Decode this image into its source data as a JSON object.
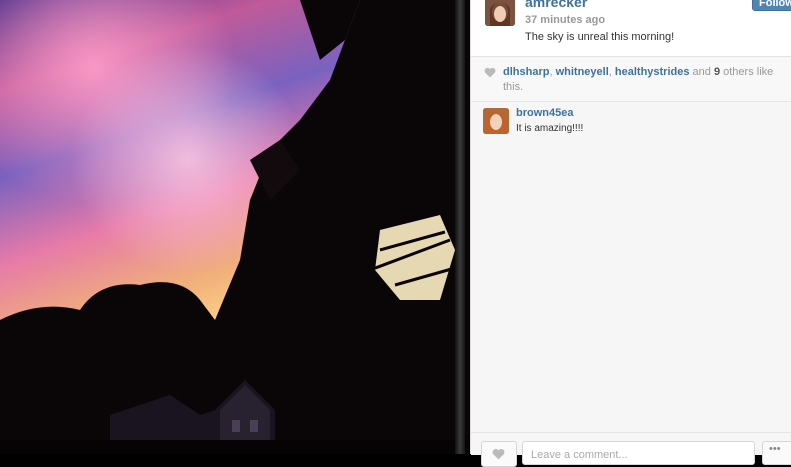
{
  "post": {
    "username": "amrecker",
    "time": "37 minutes ago",
    "caption": "The sky is unreal this morning!",
    "follow_label": "Follow"
  },
  "likes": {
    "users": [
      "dlhsharp",
      "whitneyell",
      "healthystrides"
    ],
    "sep1": ", ",
    "sep2": ", ",
    "and_text": " and ",
    "others_count": "9",
    "others_text": " others like this."
  },
  "comments": [
    {
      "username": "brown45ea",
      "text": "It is amazing!!!!"
    }
  ],
  "footer": {
    "comment_placeholder": "Leave a comment...",
    "more_label": "•••"
  },
  "colors": {
    "link_blue": "#3f729b",
    "follow_blue": "#5285b4",
    "panel_bg": "#f6f6f6"
  },
  "icons": {
    "like": "heart-icon",
    "more": "ellipsis-icon"
  }
}
